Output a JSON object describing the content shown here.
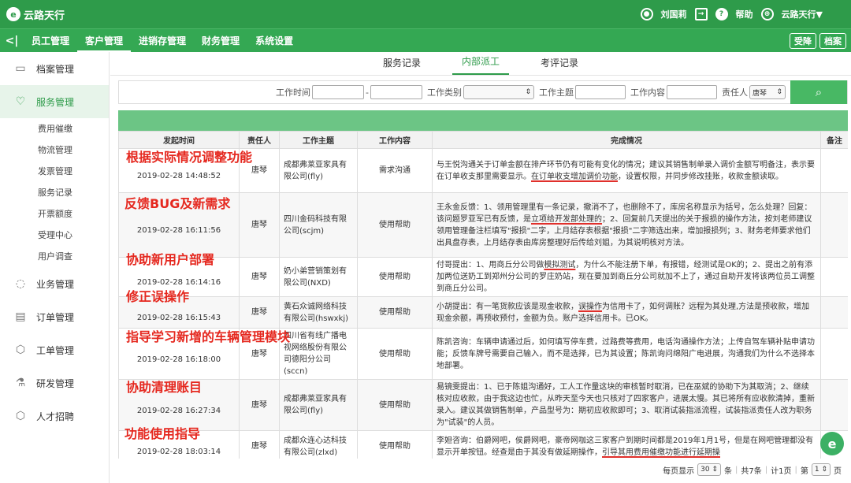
{
  "header": {
    "brand": "云路天行",
    "brand_mark": "e",
    "user_name": "刘国莉",
    "help_label": "帮助",
    "org_name": "云路天行▼",
    "icons": [
      "user-icon",
      "logout-icon",
      "help-icon",
      "org-icon"
    ]
  },
  "nav": {
    "back_glyph": "<|",
    "items": [
      "员工管理",
      "客户管理",
      "进销存管理",
      "财务管理",
      "系统设置"
    ],
    "active": "客户管理",
    "right_buttons": [
      "受降",
      "档案"
    ]
  },
  "sidebar": {
    "archive": "档案管理",
    "service": "服务管理",
    "service_sub": [
      "费用催缴",
      "物流管理",
      "发票管理",
      "服务记录",
      "开票额度",
      "受理中心",
      "用户调查"
    ],
    "business": "业务管理",
    "order": "订单管理",
    "ticket": "工单管理",
    "rd": "研发管理",
    "talent": "人才招聘"
  },
  "tabs": [
    "服务记录",
    "内部派工",
    "考评记录"
  ],
  "active_tab": "内部派工",
  "filter": {
    "time_label": "工作时间",
    "range_sep": "-",
    "type_label": "工作类别",
    "theme_label": "工作主题",
    "content_label": "工作内容",
    "owner_label": "责任人",
    "owner_value": "唐琴",
    "search_glyph": "🔍"
  },
  "table": {
    "headers": [
      "发起时间",
      "责任人",
      "工作主题",
      "工作内容",
      "完成情况",
      "备注"
    ],
    "rows": [
      {
        "time": "2019-02-28 14:48:52",
        "owner": "唐琴",
        "theme": "成都弗莱亚家具有限公司(fly)",
        "content": "需求沟通",
        "done_pre": "与王悦沟通关于订单金额在排产环节仍有可能有变化的情况；建议其销售制单录入调价金额写明备注，表示要在订单收支那里需要显示。",
        "done_ul": "在订单收支增加调价功能",
        "done_post": "，设置权限，并同步修改挂账，收款金额读取。",
        "note": "",
        "annotation": "根据实际情况调整功能"
      },
      {
        "time": "2019-02-28 16:11:56",
        "owner": "唐琴",
        "theme": "四川金码科技有限公司(scjm)",
        "content": "使用帮助",
        "done_pre": "王永金反馈：1、领用管理里有一条记录，撤消不了，也删除不了，库房名称显示为括号，怎么处理？回复：该问题罗亚军已有反馈，是",
        "done_ul": "立项给开发部处理的",
        "done_post": "；2、回复前几天提出的关于报损的操作方法，按刘老师建议领用管理备注栏填写\"报损\"二字，上月结存表根据\"报损\"二字筛选出来，增加报损列；3、财务老师要求他们出具盘存表，上月结存表由库房整理好后传给刘姐，为其说明核对方法。",
        "note": "",
        "annotation": "反馈BUG及新需求"
      },
      {
        "time": "2019-02-28 16:14:16",
        "owner": "唐琴",
        "theme": "奶小弟营销策划有限公司(NXD)",
        "content": "使用帮助",
        "done_pre": "付哥提出：1、用商丘分公司做",
        "done_ul": "模拟测试",
        "done_post": "，为什么不能注册下单，有报错，经测试是OK的；2、提出之前有添加两位送奶工到郑州分公司的罗庄奶站，现在要加到商丘分公司就加不上了，通过自助开发将该两位员工调整到商丘分公司。",
        "note": "",
        "annotation": "协助新用户部署"
      },
      {
        "time": "2019-02-28 16:15:43",
        "owner": "唐琴",
        "theme": "黄石众诚网络科技有限公司(hswxkj)",
        "content": "使用帮助",
        "done_pre": "小胡提出：有一笔货款应该是现金收款，",
        "done_ul": "误操作",
        "done_post": "为信用卡了，如何调账？远程为其处理,方法是预收款，增加现金余额，再预收预付，金额为负。账户选择信用卡。已OK。",
        "note": "",
        "annotation": "修正误操作"
      },
      {
        "time": "2019-02-28 16:18:00",
        "owner": "唐琴",
        "theme": "四川省有线广播电视网络股份有限公司德阳分公司(sccn)",
        "content": "使用帮助",
        "done_pre": "陈凯咨询：车辆申请通过后，如何填写停车费，过路费等费用，电话沟通操作方法；上传自驾车辆补贴申请功能；反馈车牌号需要自己输入，而不是选择，已为其设置；陈凯询问绵阳广电进展，沟通我们为什么不选择本地部署。",
        "done_ul": "",
        "done_post": "",
        "note": "",
        "annotation": "指导学习新增的车辆管理模块"
      },
      {
        "time": "2019-02-28 16:27:34",
        "owner": "唐琴",
        "theme": "成都弗莱亚家具有限公司(fly)",
        "content": "使用帮助",
        "done_pre": "易镜雯提出：1、已于陈姐沟通好，工人工作量这块的审核暂时取消，已在巫斌的协助下为其取消；2、继续核对应收款，由于我这边也忙，从昨天至今天也只核对了四家客户，进展太慢。其已将所有应收款清掉，重新录入。建议其做销售制单，产品型号为：期初应收款即可；3、取消试装指派流程，试装指派责任人改为职务为\"试装\"的人员。",
        "done_ul": "",
        "done_post": "",
        "note": "",
        "annotation": "协助清理账目"
      },
      {
        "time": "2019-02-28 18:03:14",
        "owner": "唐琴",
        "theme": "成都众连心达科技有限公司(zlxd)",
        "content": "使用帮助",
        "done_pre": "李妲咨询：伯爵网吧，侯爵网吧，豪帝网咖这三家客户到期时间都是2019年1月1号，但是在网吧管理都没有显示开单按钮。经查是由于其没有做延期操作，",
        "done_ul": "引导其用费用催缴功能进行延期操",
        "done_post": "",
        "note": "",
        "annotation": "功能使用指导"
      }
    ]
  },
  "pager": {
    "per_page_label": "每页显示",
    "per_page_value": "30",
    "unit": "条",
    "total": "共7条",
    "pages": "计1页",
    "page_pre": "第",
    "page_value": "1",
    "page_post": "页"
  },
  "float_glyph": "e"
}
